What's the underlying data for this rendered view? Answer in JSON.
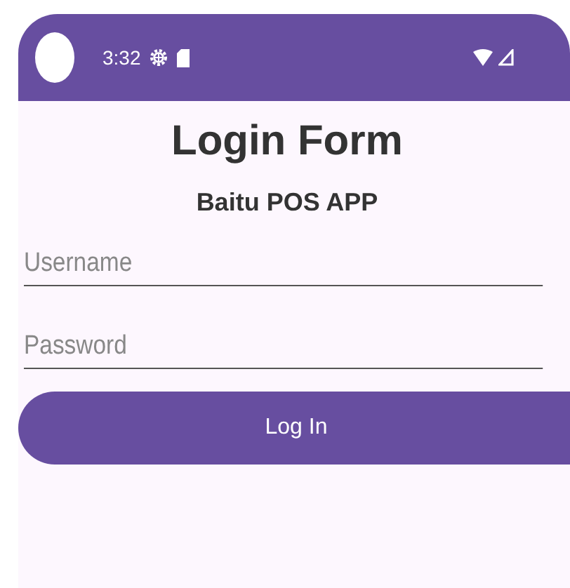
{
  "status_bar": {
    "time": "3:32"
  },
  "title": "Login Form",
  "subtitle": "Baitu POS APP",
  "fields": [
    {
      "placeholder": "Username"
    },
    {
      "placeholder": "Password"
    }
  ],
  "button": "Log In"
}
